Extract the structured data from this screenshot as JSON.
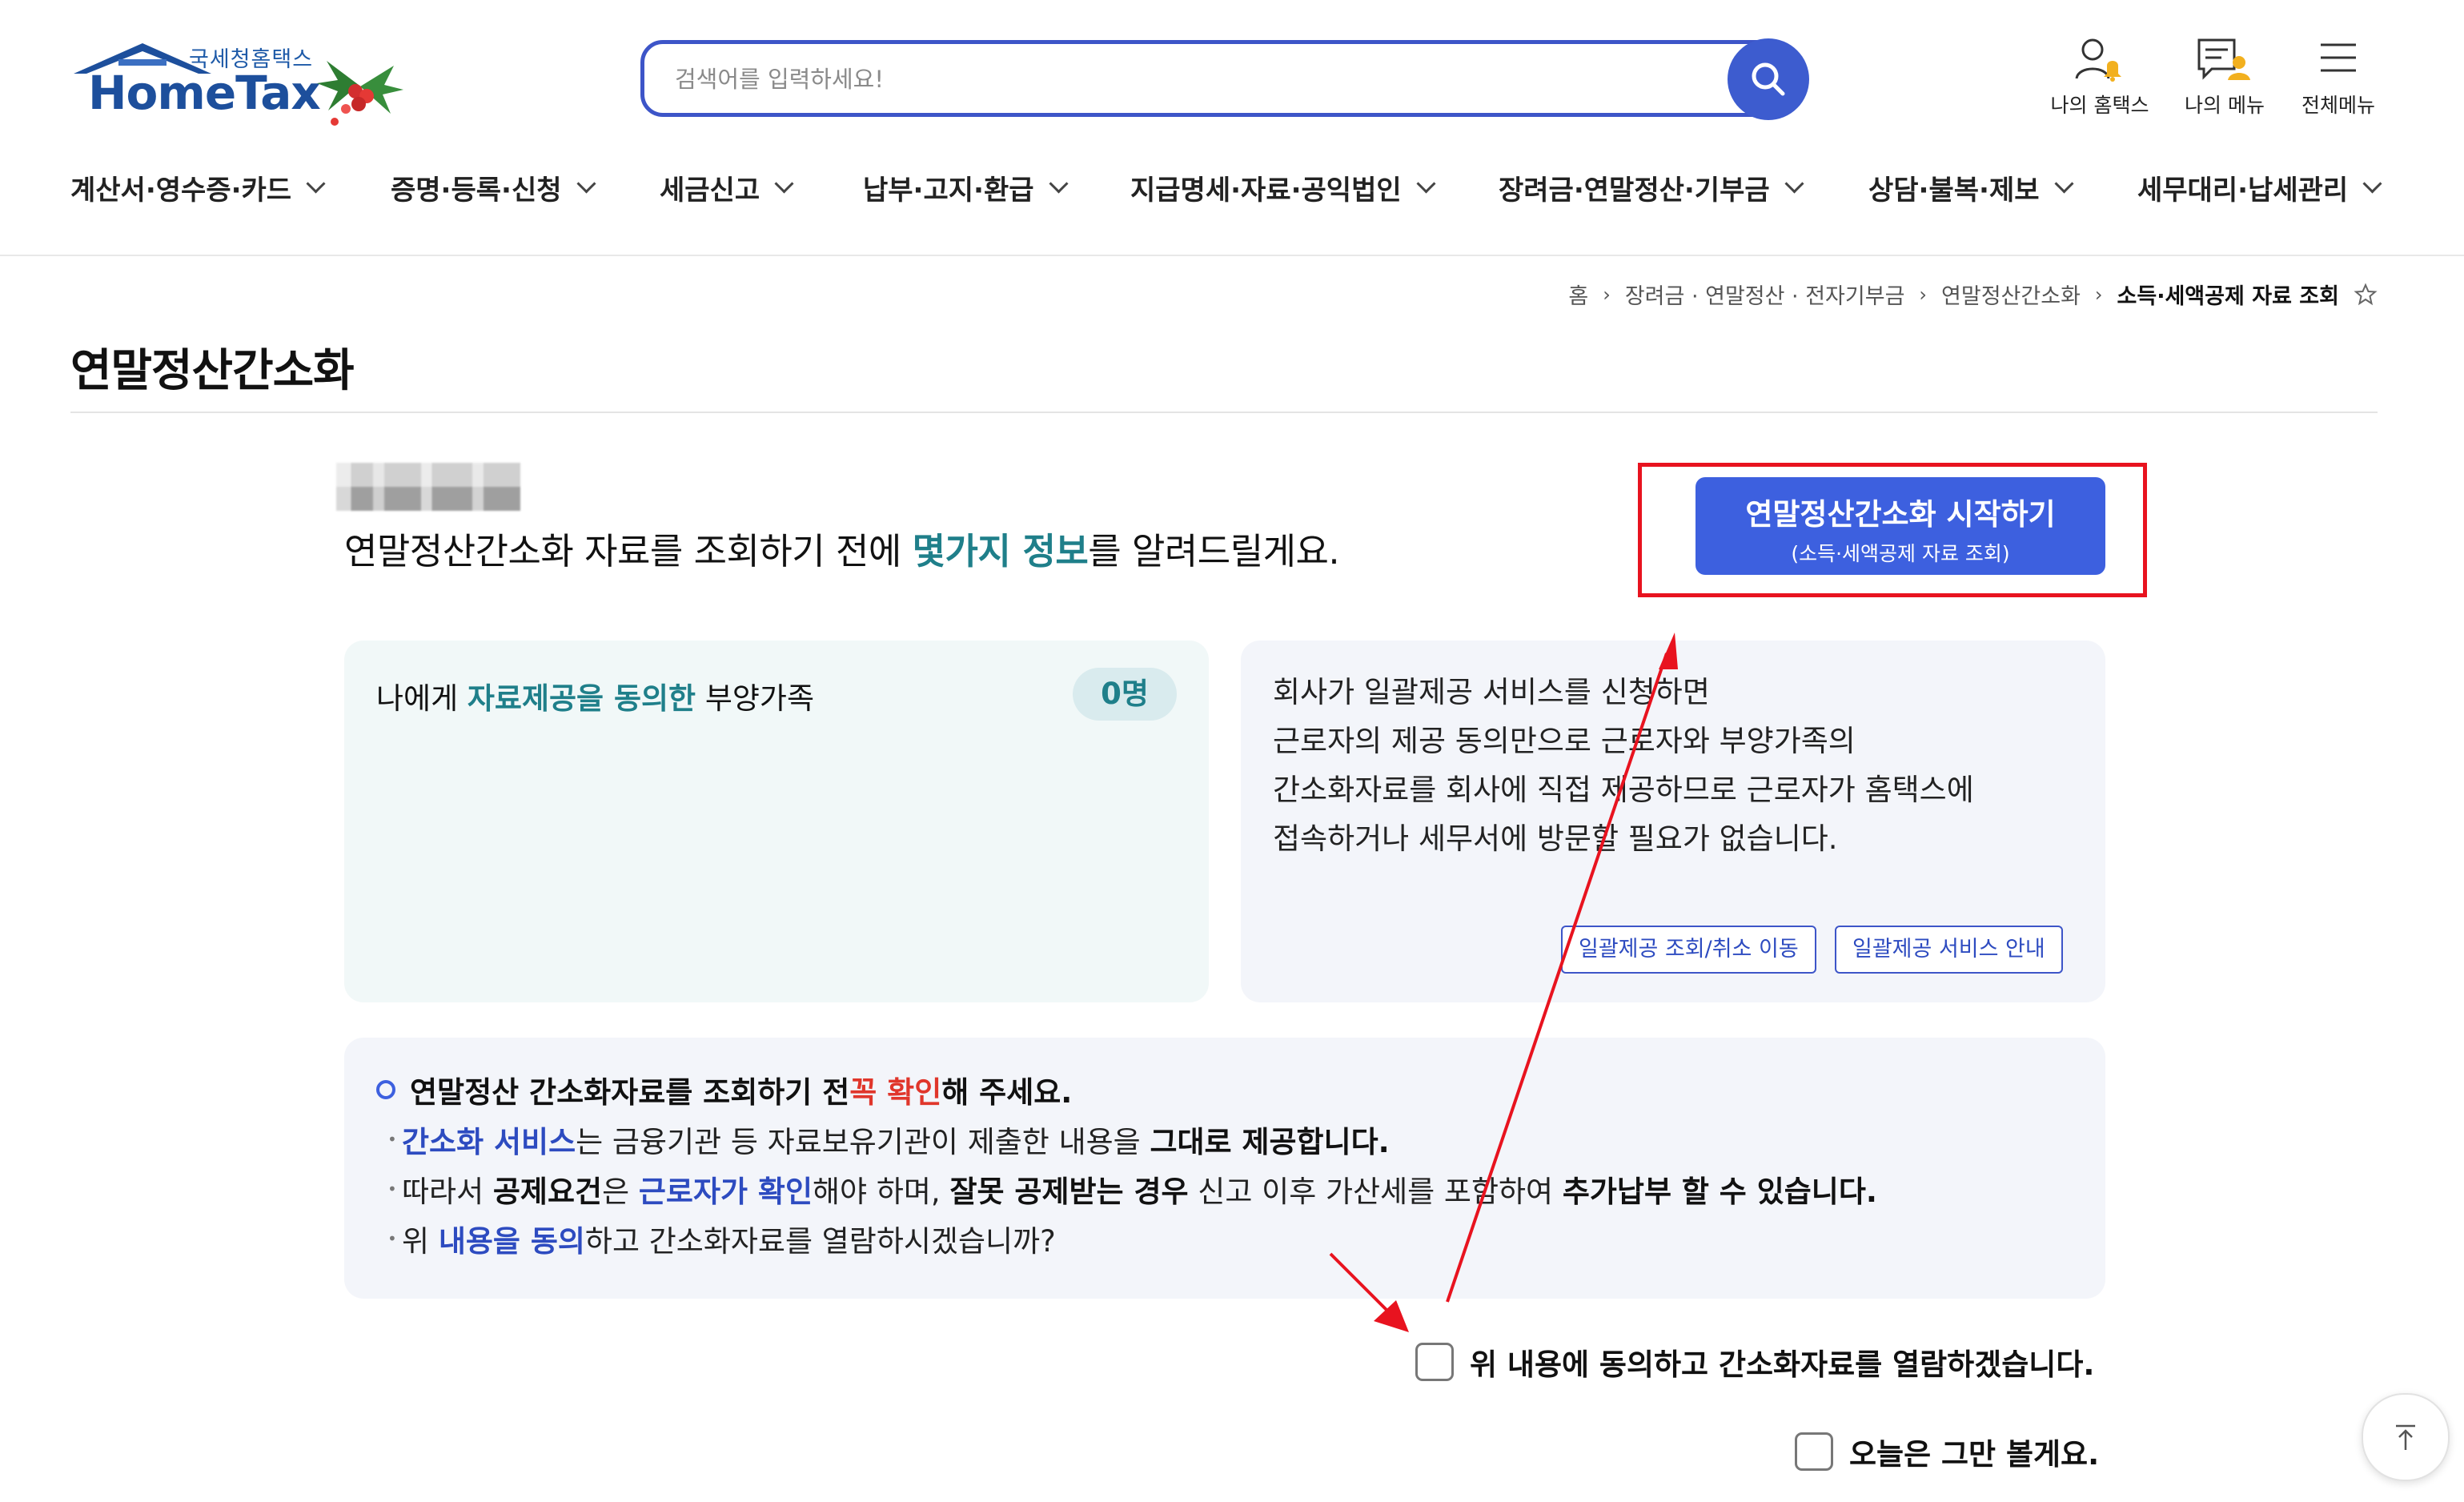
{
  "header": {
    "logo_sub": "국세청홈택스",
    "logo_main": "HomeTax",
    "search_placeholder": "검색어를 입력하세요!",
    "util": [
      {
        "label": "나의 홈택스",
        "icon": "user-bell-icon"
      },
      {
        "label": "나의 메뉴",
        "icon": "my-menu-icon"
      },
      {
        "label": "전체메뉴",
        "icon": "hamburger-icon"
      }
    ]
  },
  "nav": [
    "계산서·영수증·카드",
    "증명·등록·신청",
    "세금신고",
    "납부·고지·환급",
    "지급명세·자료·공익법인",
    "장려금·연말정산·기부금",
    "상담·불복·제보",
    "세무대리·납세관리"
  ],
  "breadcrumb": [
    "홈",
    "장려금 · 연말정산 · 전자기부금",
    "연말정산간소화",
    "소득·세액공제 자료 조회"
  ],
  "page_title": "연말정산간소화",
  "intro": {
    "before": "연말정산간소화 자료를 조회하기 전에 ",
    "highlight": "몇가지 정보",
    "after": "를 알려드릴게요."
  },
  "start_button": {
    "line1": "연말정산간소화 시작하기",
    "line2": "(소득·세액공제 자료 조회)"
  },
  "dependents_card": {
    "prefix": "나에게 ",
    "highlight": "자료제공을 동의한",
    "suffix": " 부양가족",
    "count": "0명"
  },
  "batch_card": {
    "lines": [
      "회사가 일괄제공 서비스를 신청하면",
      "근로자의 제공 동의만으로 근로자와 부양가족의",
      "간소화자료를 회사에 직접 제공하므로 근로자가 홈택스에",
      "접속하거나 세무서에 방문할 필요가 없습니다."
    ],
    "btn_query": "일괄제공 조회/취소 이동",
    "btn_guide": "일괄제공 서비스 안내"
  },
  "notice": {
    "head_before": "연말정산 간소화자료를 조회하기 전 ",
    "head_red": "꼭 확인",
    "head_after": "해 주세요.",
    "b1_a": "간소화 서비스",
    "b1_b": "는 금융기관 등 자료보유기관이 제출한 내용을 ",
    "b1_c": "그대로 제공합니다.",
    "b2_a": "따라서 ",
    "b2_b": "공제요건",
    "b2_c": "은 ",
    "b2_d": "근로자가 확인",
    "b2_e": "해야 하며, ",
    "b2_f": "잘못 공제받는 경우",
    "b2_g": " 신고 이후 가산세를 포함하여 ",
    "b2_h": "추가납부 할 수 있습니다.",
    "b3_a": "위 ",
    "b3_b": "내용을 동의",
    "b3_c": "하고 간소화자료를 열람하시겠습니까?"
  },
  "agree_label": "위 내용에 동의하고 간소화자료를 열람하겠습니다.",
  "dismiss_label": "오늘은 그만 볼게요.",
  "colors": {
    "accent_blue": "#3d60df",
    "teal": "#1f7f8a",
    "annotation_red": "#e8131f"
  }
}
